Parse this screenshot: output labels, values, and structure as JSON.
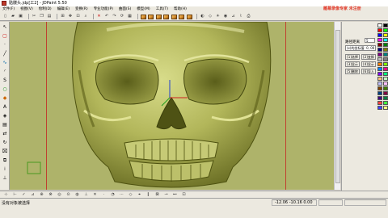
{
  "window": {
    "title": "骷髅头.jdp[工2] - JDPaint 5.50",
    "watermark": "雕幕录像专家 未注册"
  },
  "menu": [
    "文件(F)",
    "视图(V)",
    "绘制(D)",
    "编辑(E)",
    "变换(R)",
    "专业功能(P)",
    "曲面(S)",
    "模型(M)",
    "工具(T)",
    "帮助(H)"
  ],
  "right_panel": {
    "spacing_label": "路径距离",
    "spacing_value": "5",
    "coord_field": "(x)的坐标值: 0, 00",
    "buttons": [
      "[1]选择",
      "[2]变换",
      "[3]显示",
      "[4]显示",
      "[5]删除",
      "[6]导入"
    ]
  },
  "status": {
    "message": "没有对象被选择",
    "coords": "-12.06  -10.16  0.00"
  },
  "colors": {
    "canvas": "#aeb36a",
    "model": "#b4b85c",
    "guide": "#c04030",
    "axis_x": "#d02020",
    "axis_y": "#2040d0",
    "watermark": "#e23a2a"
  },
  "palette": [
    "#ffffff",
    "#000000",
    "#ff0000",
    "#00ff00",
    "#0000ff",
    "#ffff00",
    "#ff00ff",
    "#00ffff",
    "#800000",
    "#008000",
    "#000080",
    "#808000",
    "#800080",
    "#008080",
    "#c0c0c0",
    "#808080",
    "#ff8000",
    "#80ff00",
    "#0080ff",
    "#ff0080",
    "#8000ff",
    "#00ff80",
    "#ffc080",
    "#c0ffc0",
    "#c0c0ff",
    "#ffc0ff",
    "#804000",
    "#408000",
    "#004080",
    "#800040",
    "#400080",
    "#008040",
    "#ff4040",
    "#40ff40",
    "#4040ff",
    "#ffff80"
  ]
}
